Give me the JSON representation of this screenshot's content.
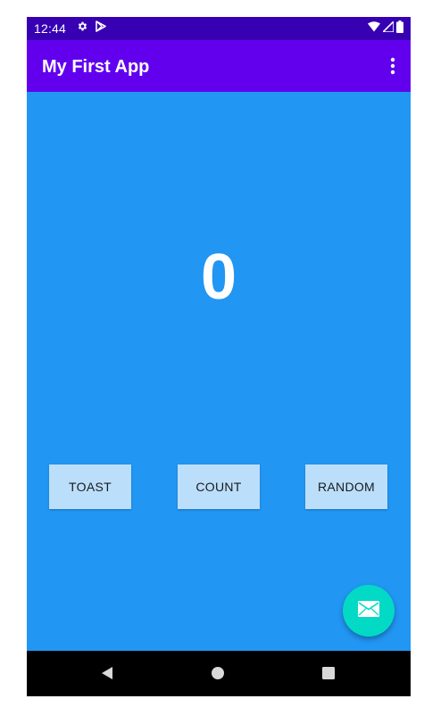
{
  "status_bar": {
    "time": "12:44",
    "icons": [
      "settings-icon",
      "play-store-icon",
      "wifi-icon",
      "signal-icon",
      "battery-icon"
    ]
  },
  "app_bar": {
    "title": "My First App",
    "menu_icon": "more-vert-icon"
  },
  "main": {
    "count": "0",
    "buttons": {
      "toast": "TOAST",
      "count": "COUNT",
      "random": "RANDOM"
    },
    "fab_icon": "email-icon"
  },
  "nav_bar": {
    "icons": [
      "back-icon",
      "home-icon",
      "recents-icon"
    ]
  },
  "colors": {
    "status_bar": "#3700B3",
    "app_bar": "#6200EE",
    "content_background": "#2196F3",
    "button_background": "#BBDEFB",
    "fab": "#03DAC5",
    "nav_bar": "#000000"
  }
}
